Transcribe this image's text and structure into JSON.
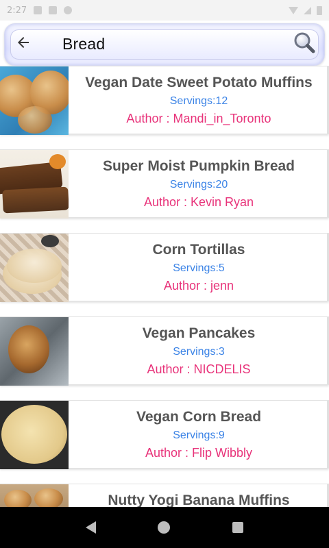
{
  "status_bar": {
    "time": "2:27",
    "icons": [
      "shield-icon",
      "sd-card-icon",
      "no-sync-icon"
    ],
    "right_icons": [
      "wifi-icon",
      "signal-icon",
      "battery-icon"
    ]
  },
  "search": {
    "query": "Bread",
    "back_icon": "arrow-left-icon",
    "search_icon": "magnifier-icon"
  },
  "recipes": [
    {
      "title": "Vegan Date Sweet Potato Muffins",
      "servings": "Servings:12",
      "author": "Author : Mandi_in_Toronto",
      "photo": "muffins"
    },
    {
      "title": "Super Moist Pumpkin Bread",
      "servings": "Servings:20",
      "author": "Author : Kevin Ryan",
      "photo": "pumpkin-bread"
    },
    {
      "title": "Corn Tortillas",
      "servings": "Servings:5",
      "author": "Author : jenn",
      "photo": "tortillas"
    },
    {
      "title": "Vegan Pancakes",
      "servings": "Servings:3",
      "author": "Author : NICDELIS",
      "photo": "pancake"
    },
    {
      "title": "Vegan Corn Bread",
      "servings": "Servings:9",
      "author": "Author : Flip Wibbly",
      "photo": "corn-bread"
    },
    {
      "title": "Nutty Yogi Banana Muffins",
      "servings": "",
      "author": "",
      "photo": "banana-muffins"
    }
  ],
  "colors": {
    "title": "#555555",
    "servings": "#3b83e6",
    "author": "#e8337a"
  },
  "nav_bar": {
    "icons": [
      "back-triangle-icon",
      "home-circle-icon",
      "recents-square-icon"
    ]
  }
}
